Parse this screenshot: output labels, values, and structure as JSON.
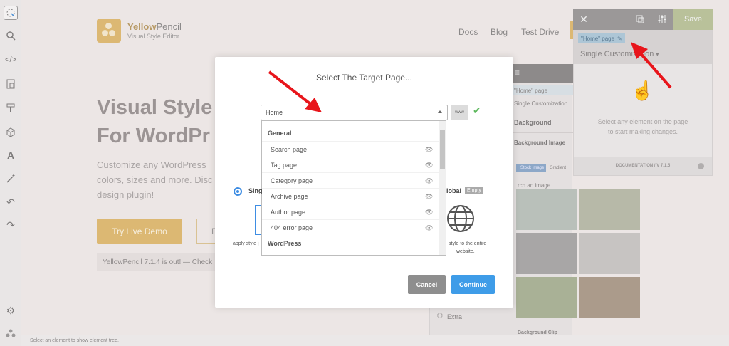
{
  "brand": {
    "name_a": "Yellow",
    "name_b": "Pencil",
    "tagline": "Visual Style Editor"
  },
  "nav": [
    "Docs",
    "Blog",
    "Test Drive"
  ],
  "hero": {
    "line1": "Visual Style",
    "line2": "For WordPr",
    "p1": "Customize any WordPress",
    "p2": "colors, sizes and more. Disc",
    "p3": "design plugin!",
    "demo_button": "Try Live Demo",
    "other_button": "E",
    "notice": "YellowPencil 7.1.4 is out! — Check"
  },
  "editor": {
    "save_label": "Save",
    "target_label": "\"Home\" page",
    "customization": "Single Customization",
    "hint_line1": "Select any element on the page",
    "hint_line2": "to start making changes.",
    "footer": "DOCUMENTATION / V 7.1.5"
  },
  "props": {
    "home_page": "\"Home\" page",
    "customization": "Single Customization",
    "background": "Background",
    "background_image": "Background Image",
    "stock_image": "Stock Image",
    "gradient": "Gradient",
    "search": "rch an image",
    "extra": "Extra",
    "background_clip": "Background Clip"
  },
  "statusbar": "Select an element to show element tree.",
  "modal": {
    "title": "Select The Target Page...",
    "selected": "Home",
    "www_label": "www",
    "groups": [
      {
        "label": "General",
        "items": [
          "Search page",
          "Tag page",
          "Category page",
          "Archive page",
          "Author page",
          "404 error page"
        ]
      },
      {
        "label": "WordPress",
        "items": []
      }
    ],
    "single_label": "Sing",
    "single_desc": "apply style j",
    "global_label": "lobal",
    "empty_badge": "Empty",
    "global_desc_1": "style to the entire",
    "global_desc_2": "website.",
    "cancel": "Cancel",
    "continue": "Continue"
  },
  "colors": {
    "accent_blue": "#3e9ce8",
    "brand_yellow": "#dcb873",
    "arrow_red": "#e8151b",
    "check_green": "#5cb85c"
  },
  "icons": [
    "select-cursor-icon",
    "search-icon",
    "code-icon",
    "responsive-icon",
    "brush-icon",
    "cube-icon",
    "font-icon",
    "wand-icon",
    "undo-icon",
    "redo-icon",
    "gear-icon",
    "hierarchy-icon",
    "eye-icon",
    "globe-icon",
    "hand-pointer-icon"
  ]
}
